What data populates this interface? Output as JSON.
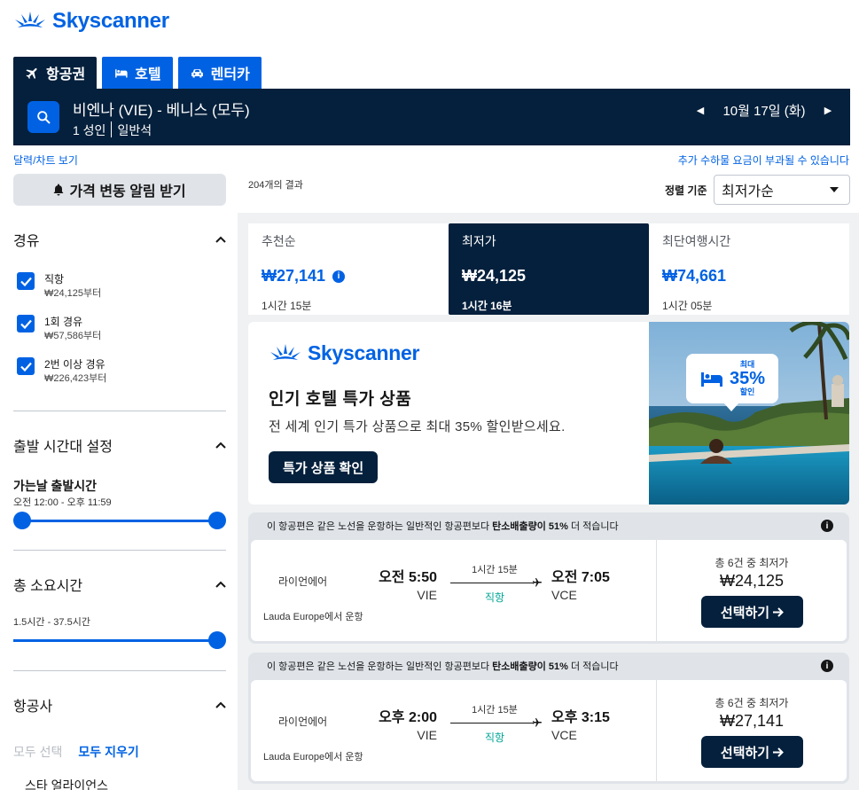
{
  "brand": {
    "name": "Skyscanner",
    "color": "#0062e3",
    "dark": "#05203c"
  },
  "tabs": [
    {
      "label": "항공권",
      "icon": "plane-icon",
      "active": true
    },
    {
      "label": "호텔",
      "icon": "bed-icon",
      "active": false
    },
    {
      "label": "렌터카",
      "icon": "car-icon",
      "active": false
    }
  ],
  "search": {
    "route": "비엔나 (VIE) - 베니스 (모두)",
    "passengers": "1 성인",
    "cabin": "일반석",
    "date": "10월 17일 (화)"
  },
  "links": {
    "calendar": "달력/차트 보기",
    "fees": "추가 수하물 요금이 부과될 수 있습니다"
  },
  "sidebar": {
    "alert_label": "가격 변동 알림 받기",
    "stops": {
      "title": "경유",
      "options": [
        {
          "label": "직항",
          "price": "₩24,125부터",
          "checked": true
        },
        {
          "label": "1회 경유",
          "price": "₩57,586부터",
          "checked": true
        },
        {
          "label": "2번 이상 경유",
          "price": "₩226,423부터",
          "checked": true
        }
      ]
    },
    "departure": {
      "title": "출발 시간대 설정",
      "sub_title": "가는날 출발시간",
      "range": "오전 12:00 - 오후 11:59"
    },
    "duration": {
      "title": "총 소요시간",
      "range": "1.5시간 - 37.5시간"
    },
    "airlines": {
      "title": "항공사",
      "select_all": "모두 선택",
      "clear_all": "모두 지우기",
      "first_group": "스타 얼라이언스"
    }
  },
  "results": {
    "count": "204개의 결과",
    "sort_label": "정렬 기준",
    "sort_value": "최저가순"
  },
  "sort_tabs": [
    {
      "name": "추천순",
      "price": "₩27,141",
      "duration": "1시간 15분",
      "active": false,
      "info": "i"
    },
    {
      "name": "최저가",
      "price": "₩24,125",
      "duration": "1시간 16분",
      "active": true
    },
    {
      "name": "최단여행시간",
      "price": "₩74,661",
      "duration": "1시간 05분",
      "active": false
    }
  ],
  "ad": {
    "logo_text": "Skyscanner",
    "title": "인기 호텔 특가 상품",
    "description": "전 세계 인기 특가 상품으로 최대 35% 할인받으세요.",
    "cta": "특가 상품 확인",
    "badge_top": "최대",
    "badge_value": "35%",
    "badge_bottom": "할인"
  },
  "flights": [
    {
      "eco_prefix": "이 항공편은 같은 노선을 운항하는 일반적인 항공편보다 ",
      "eco_bold": "탄소배출량이 51%",
      "eco_suffix": " 더 적습니다",
      "airline": "라이언에어",
      "operated_by": "Lauda Europe에서 운항",
      "dep_time": "오전 5:50",
      "dep_code": "VIE",
      "duration": "1시간 15분",
      "stops": "직항",
      "arr_time": "오전 7:05",
      "arr_code": "VCE",
      "deal_label": "총 6건 중 최저가",
      "price": "₩24,125",
      "select_label": "선택하기"
    },
    {
      "eco_prefix": "이 항공편은 같은 노선을 운항하는 일반적인 항공편보다 ",
      "eco_bold": "탄소배출량이 51%",
      "eco_suffix": " 더 적습니다",
      "airline": "라이언에어",
      "operated_by": "Lauda Europe에서 운항",
      "dep_time": "오후 2:00",
      "dep_code": "VIE",
      "duration": "1시간 15분",
      "stops": "직항",
      "arr_time": "오후 3:15",
      "arr_code": "VCE",
      "deal_label": "총 6건 중 최저가",
      "price": "₩27,141",
      "select_label": "선택하기"
    }
  ]
}
